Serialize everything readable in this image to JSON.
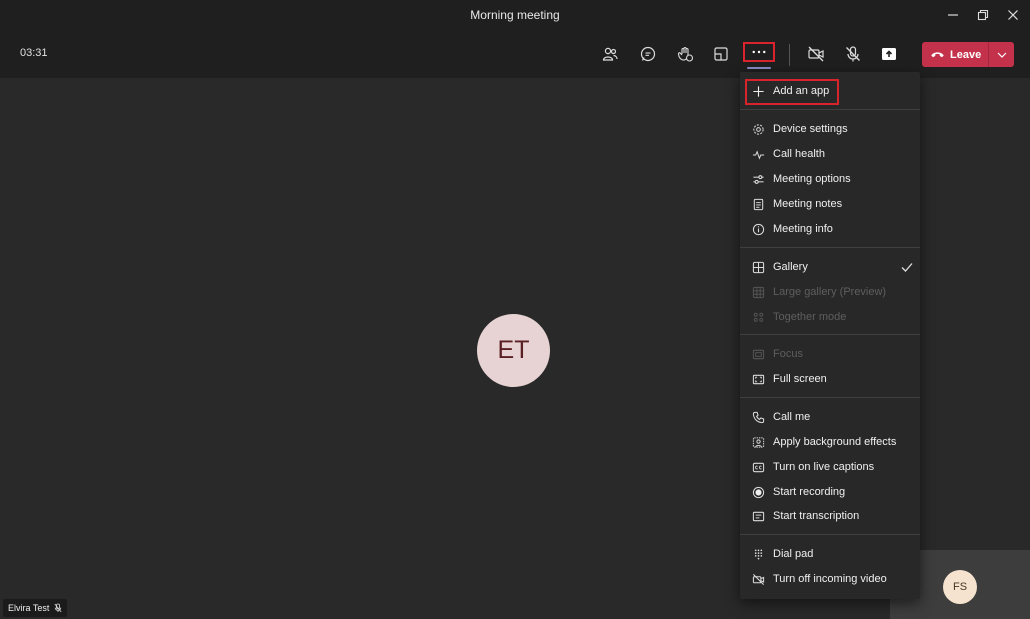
{
  "window": {
    "title": "Morning meeting"
  },
  "toolbar": {
    "timer": "03:31",
    "leave_label": "Leave"
  },
  "stage": {
    "main_avatar_initials": "ET",
    "self_avatar_initials": "FS",
    "name_tag": "Elvira Test"
  },
  "menu": {
    "add_app": "Add an app",
    "device_settings": "Device settings",
    "call_health": "Call health",
    "meeting_options": "Meeting options",
    "meeting_notes": "Meeting notes",
    "meeting_info": "Meeting info",
    "gallery": "Gallery",
    "large_gallery": "Large gallery (Preview)",
    "together_mode": "Together mode",
    "focus": "Focus",
    "full_screen": "Full screen",
    "call_me": "Call me",
    "background_effects": "Apply background effects",
    "live_captions": "Turn on live captions",
    "start_recording": "Start recording",
    "start_transcription": "Start transcription",
    "dial_pad": "Dial pad",
    "turn_off_video": "Turn off incoming video"
  },
  "colors": {
    "leave": "#c4314b",
    "highlight": "#d9232d",
    "accent": "#8b8cc7"
  }
}
